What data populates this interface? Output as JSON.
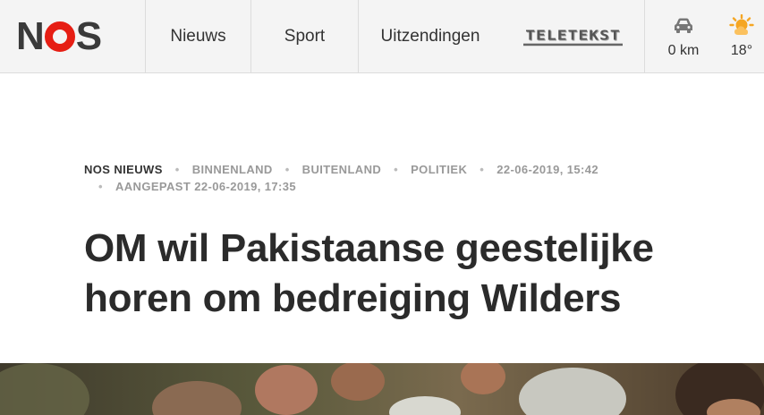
{
  "header": {
    "logo_text": "NOS",
    "nav": [
      {
        "label": "Nieuws"
      },
      {
        "label": "Sport"
      },
      {
        "label": "Uitzendingen"
      },
      {
        "label": "TELETEKST"
      }
    ],
    "traffic": {
      "icon": "car-icon",
      "value": "0 km"
    },
    "weather": {
      "icon": "sun-cloud-icon",
      "value": "18°"
    }
  },
  "article": {
    "categories": [
      "NOS NIEUWS",
      "BINNENLAND",
      "BUITENLAND",
      "POLITIEK"
    ],
    "published": "22-06-2019, 15:42",
    "updated": "AANGEPAST 22-06-2019, 17:35",
    "headline_line1": "OM wil Pakistaanse geestelijke",
    "headline_line2": "horen om bedreiging Wilders"
  },
  "colors": {
    "brand_red": "#e61e14",
    "text_dark": "#2b2b2b",
    "meta_gray": "#999999"
  }
}
